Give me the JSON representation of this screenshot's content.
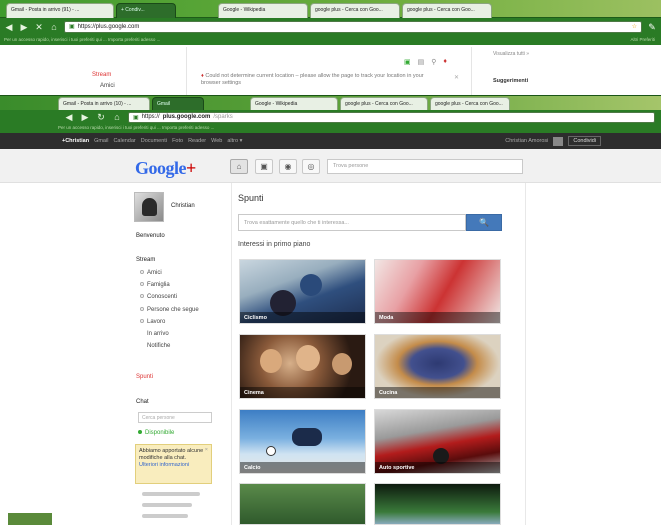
{
  "bg_window": {
    "tabs": [
      "Gmail - Posta in arrivo (91) - ...",
      "+ Condiv...",
      "Google - Wikipedia",
      "google plus - Cerca con Goo...",
      "google plus - Cerca con Goo..."
    ],
    "url": "https://plus.google.com",
    "bookmarks_bar": "Per un accesso rapido, inserisci i tuoi preferiti qui ... Importa preferiti adesso ...",
    "bookmarks_other": "Altri Preferiti",
    "left_items": [
      "Stream",
      "Amici"
    ],
    "location_notice": "Could not determine current location – please allow the page to track your location in your browser settings",
    "right_items": [
      "Visualizza tutti »",
      "Suggerimenti"
    ]
  },
  "fg_window": {
    "tabs": [
      "Gmail - Posta in arrivo (10) - ...",
      "Gmail",
      "Google - Wikipedia",
      "google plus - Cerca con Goo...",
      "google plus - Cerca con Goo..."
    ],
    "url_host": "plus.google.com",
    "url_path": "/sparks",
    "bookmarks_bar": "Per un accesso rapido, inserisci i tuoi preferiti qui ... Importa preferiti adesso ..."
  },
  "gbar": {
    "items": [
      "+Christian",
      "Gmail",
      "Calendar",
      "Documenti",
      "Foto",
      "Reader",
      "Web",
      "altro ▾"
    ],
    "user": "Christian Amorosi",
    "share": "Condividi"
  },
  "header": {
    "logo_main": "Google",
    "logo_plus": "+",
    "search_placeholder": "Trova persone"
  },
  "left": {
    "name": "Christian",
    "benvenuto": "Benvenuto",
    "stream_label": "Stream",
    "stream_items": [
      "Amici",
      "Famiglia",
      "Conoscenti",
      "Persone che segue",
      "Lavoro"
    ],
    "extra_items": [
      "In arrivo",
      "Notifiche"
    ],
    "spunti": "Spunti",
    "chat_label": "Chat",
    "chat_search": "Cerca persone",
    "status": "Disponibile",
    "tip_text": "Abbiamo apportato alcune modifiche alla chat.",
    "tip_link": "Ulteriori informazioni",
    "tip_close": "×"
  },
  "main": {
    "title": "Spunti",
    "search_placeholder": "Trova esattamente quello che ti interessa...",
    "search_button": "🔍",
    "subhead": "Interessi in primo piano",
    "tiles": [
      "Ciclismo",
      "Moda",
      "Cinema",
      "Cucina",
      "Calcio",
      "Auto sportive"
    ]
  },
  "colors": {
    "accent": "#4479ba",
    "chrome": "#2a7b25",
    "red": "#cc0000"
  }
}
